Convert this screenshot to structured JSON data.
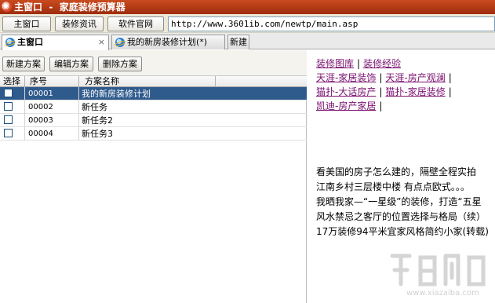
{
  "window": {
    "title": "主窗口  -  家庭装修预算器"
  },
  "toolbar": {
    "main_window": "主窗口",
    "decor_info": "装修资讯",
    "official_site": "软件官网",
    "url": "http://www.3601ib.com/newtp/main.asp"
  },
  "tabs": [
    {
      "label": "主窗口",
      "close": "×"
    },
    {
      "label": "我的新房装修计划(*)"
    },
    {
      "label": "新建"
    }
  ],
  "plan_toolbar": {
    "new": "新建方案",
    "edit": "编辑方案",
    "delete": "删除方案"
  },
  "grid": {
    "headers": {
      "select": "选择",
      "id": "序号",
      "name": "方案名称"
    },
    "rows": [
      {
        "id": "00001",
        "name": "我的新房装修计划",
        "selected": true
      },
      {
        "id": "00002",
        "name": "新任务"
      },
      {
        "id": "00003",
        "name": "新任务2"
      },
      {
        "id": "00004",
        "name": "新任务3"
      }
    ]
  },
  "links": {
    "gallery": "装修图库",
    "experience": "装修经验",
    "tianya_home": "天涯-家居装饰",
    "tianya_house": "天涯-房产观澜",
    "maopu_dalian": "猫扑-大话房产",
    "maopu_home": "猫扑-家居装修",
    "kaidi_home": "凯迪-房产家居",
    "separator": "|"
  },
  "news": [
    "看美国的房子怎么建的，隔壁全程实拍",
    "江南乡村三层楼中楼 有点点欧式。。。",
    "我晒我家—“一星级”的装修，打造“五星",
    "风水禁忌之客厅的位置选择与格局（续）",
    "17万装修94平米宜家风格简约小家(转载)"
  ],
  "watermark": {
    "text": "www.xiazaiba.com"
  },
  "colors": {
    "title_bar": "#b63a17",
    "selection": "#2f5a8c",
    "link": "#7a1070"
  }
}
